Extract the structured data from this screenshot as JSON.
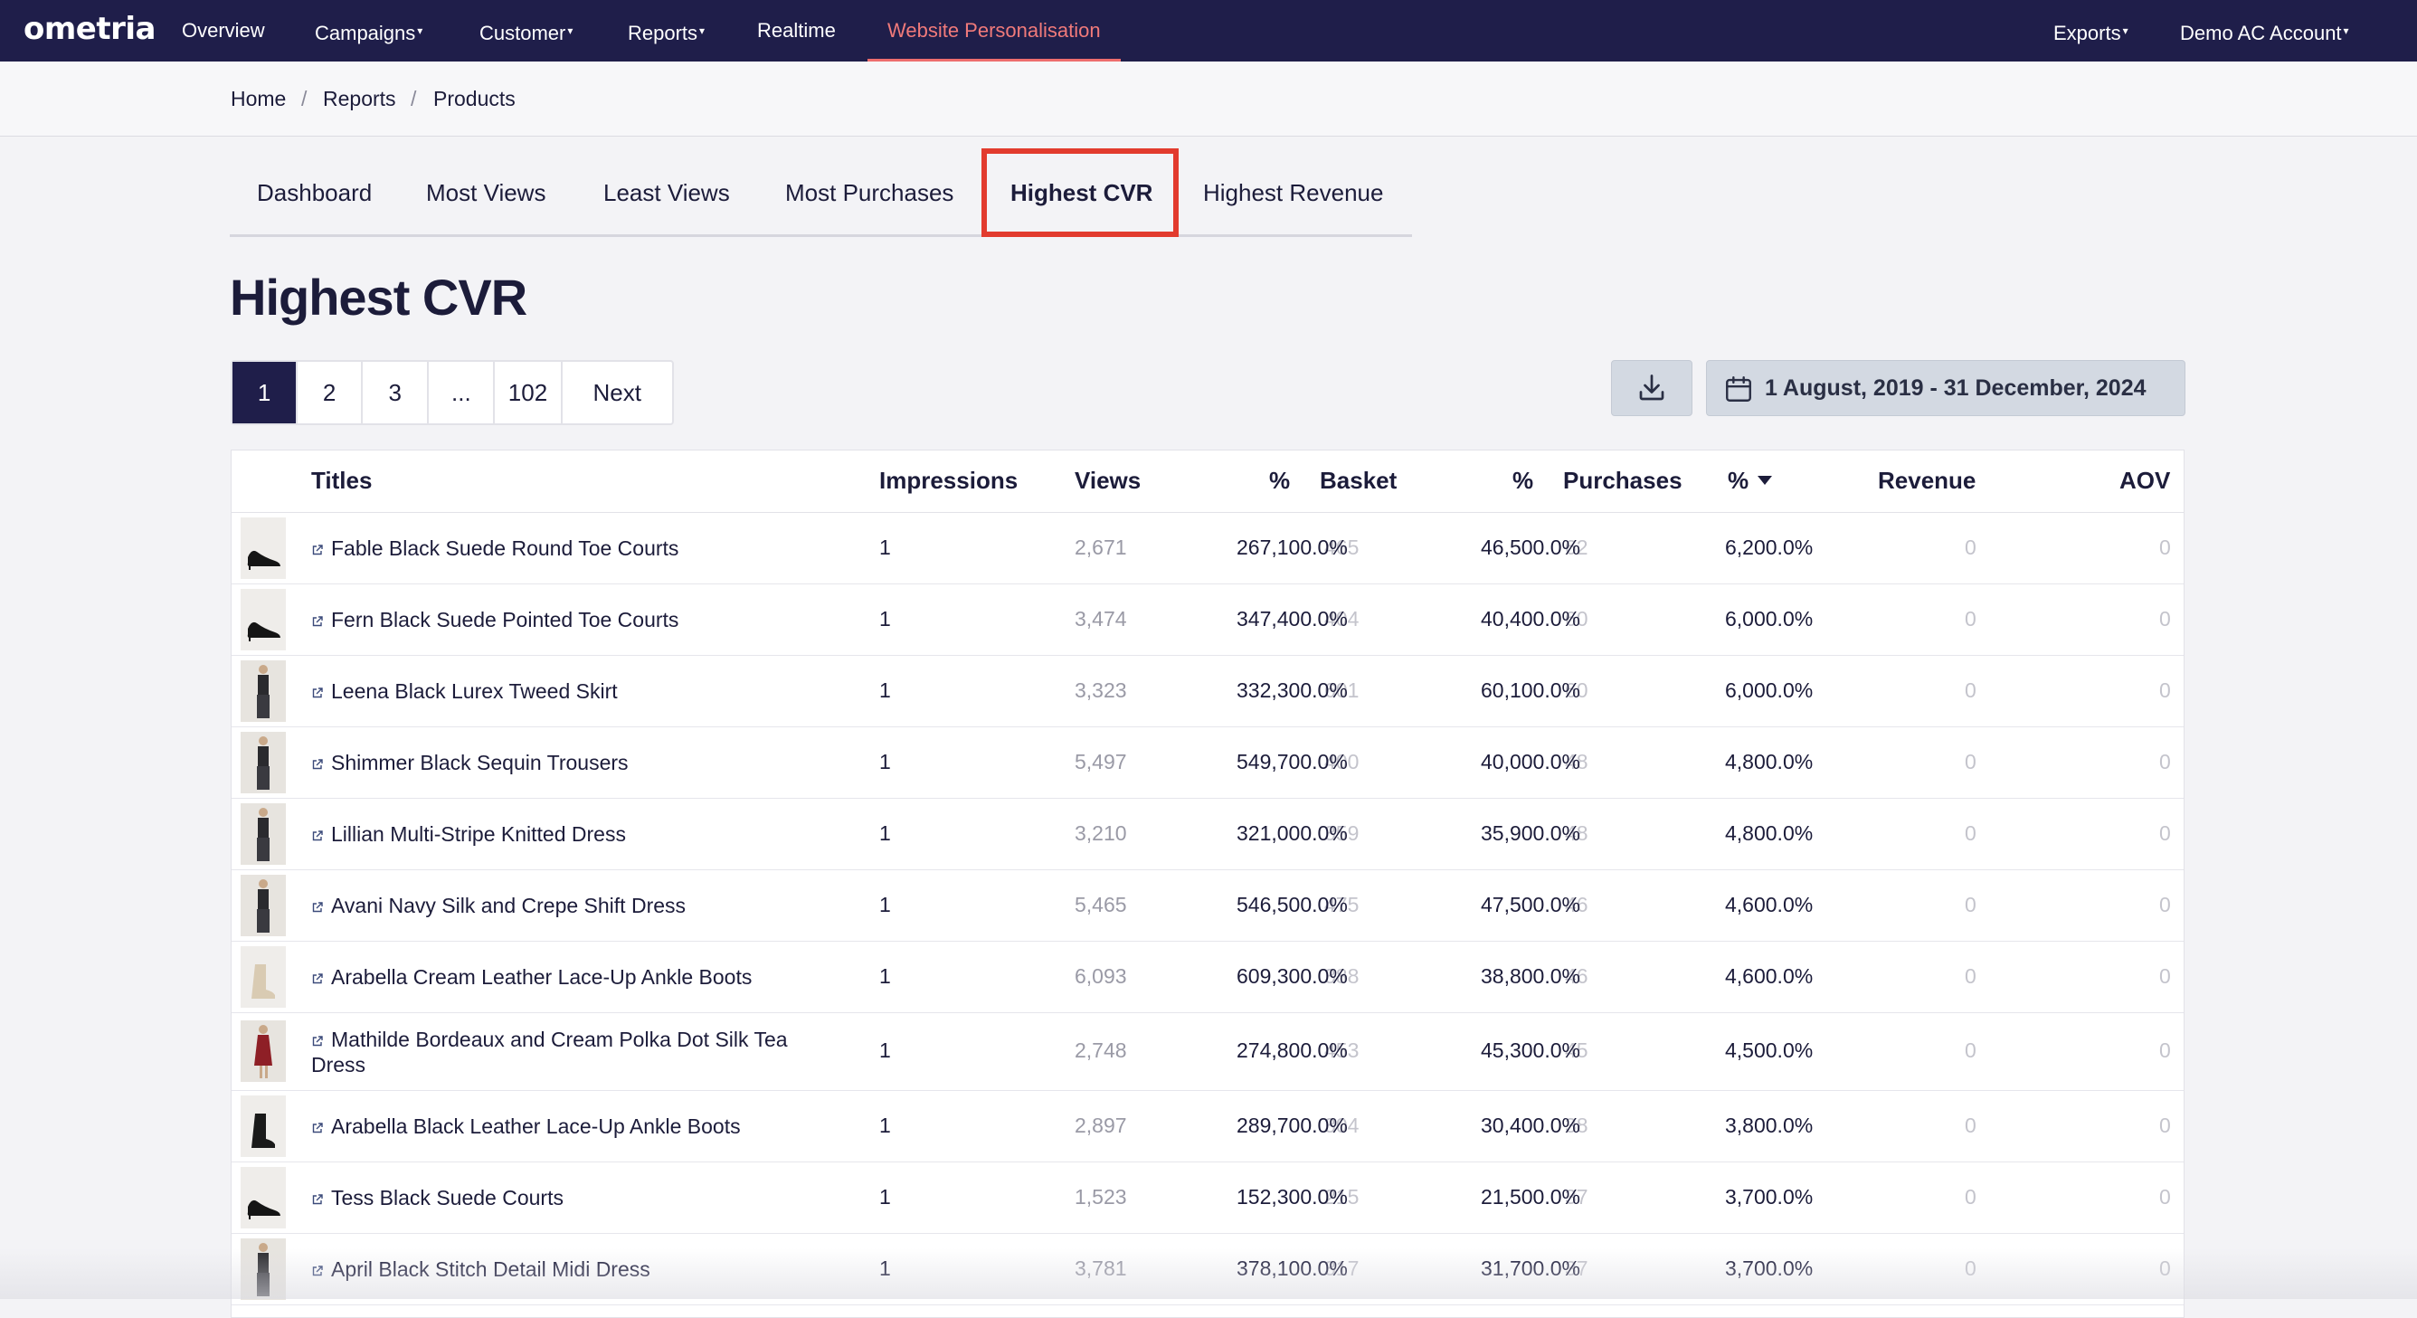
{
  "nav": {
    "logo": "ometria",
    "items": [
      {
        "label": "Overview"
      },
      {
        "label": "Campaigns",
        "caret": "▾"
      },
      {
        "label": "Customer",
        "caret": "▾"
      },
      {
        "label": "Reports",
        "caret": "▾"
      },
      {
        "label": "Realtime"
      },
      {
        "label": "Website Personalisation"
      }
    ],
    "right": [
      {
        "label": "Exports",
        "caret": "▾"
      },
      {
        "label": "Demo AC Account",
        "caret": "▾"
      }
    ]
  },
  "breadcrumb": [
    "Home",
    "Reports",
    "Products"
  ],
  "breadcrumb_sep": "/",
  "tabs": [
    "Dashboard",
    "Most Views",
    "Least Views",
    "Most Purchases",
    "Highest CVR",
    "Highest Revenue"
  ],
  "title": "Highest CVR",
  "pagination": [
    "1",
    "2",
    "3",
    "...",
    "102",
    "Next"
  ],
  "date_range": "1 August, 2019 - 31 December, 2024",
  "columns": {
    "titles": "Titles",
    "impressions": "Impressions",
    "views": "Views",
    "pct1": "%",
    "basket": "Basket",
    "pct2": "%",
    "purchases": "Purchases",
    "pct3": "%",
    "revenue": "Revenue",
    "aov": "AOV"
  },
  "rows": [
    {
      "title": "Fable Black Suede Round Toe Courts",
      "impressions": "1",
      "views": "2,671",
      "pct1": "267,100.0%",
      "basket": "465",
      "pct2": "46,500.0%",
      "purchases": "62",
      "pct3": "6,200.0%",
      "revenue": "0",
      "aov": "0",
      "thumb": "shoe"
    },
    {
      "title": "Fern Black Suede Pointed Toe Courts",
      "impressions": "1",
      "views": "3,474",
      "pct1": "347,400.0%",
      "basket": "404",
      "pct2": "40,400.0%",
      "purchases": "60",
      "pct3": "6,000.0%",
      "revenue": "0",
      "aov": "0",
      "thumb": "shoe"
    },
    {
      "title": "Leena Black Lurex Tweed Skirt",
      "impressions": "1",
      "views": "3,323",
      "pct1": "332,300.0%",
      "basket": "601",
      "pct2": "60,100.0%",
      "purchases": "60",
      "pct3": "6,000.0%",
      "revenue": "0",
      "aov": "0",
      "thumb": "person"
    },
    {
      "title": "Shimmer Black Sequin Trousers",
      "impressions": "1",
      "views": "5,497",
      "pct1": "549,700.0%",
      "basket": "400",
      "pct2": "40,000.0%",
      "purchases": "48",
      "pct3": "4,800.0%",
      "revenue": "0",
      "aov": "0",
      "thumb": "person"
    },
    {
      "title": "Lillian Multi-Stripe Knitted Dress",
      "impressions": "1",
      "views": "3,210",
      "pct1": "321,000.0%",
      "basket": "359",
      "pct2": "35,900.0%",
      "purchases": "48",
      "pct3": "4,800.0%",
      "revenue": "0",
      "aov": "0",
      "thumb": "person"
    },
    {
      "title": "Avani Navy Silk and Crepe Shift Dress",
      "impressions": "1",
      "views": "5,465",
      "pct1": "546,500.0%",
      "basket": "475",
      "pct2": "47,500.0%",
      "purchases": "46",
      "pct3": "4,600.0%",
      "revenue": "0",
      "aov": "0",
      "thumb": "person"
    },
    {
      "title": "Arabella Cream Leather Lace-Up Ankle Boots",
      "impressions": "1",
      "views": "6,093",
      "pct1": "609,300.0%",
      "basket": "388",
      "pct2": "38,800.0%",
      "purchases": "46",
      "pct3": "4,600.0%",
      "revenue": "0",
      "aov": "0",
      "thumb": "boot-cream"
    },
    {
      "title": "Mathilde Bordeaux and Cream Polka Dot Silk Tea Dress",
      "impressions": "1",
      "views": "2,748",
      "pct1": "274,800.0%",
      "basket": "453",
      "pct2": "45,300.0%",
      "purchases": "45",
      "pct3": "4,500.0%",
      "revenue": "0",
      "aov": "0",
      "thumb": "person-red"
    },
    {
      "title": "Arabella Black Leather Lace-Up Ankle Boots",
      "impressions": "1",
      "views": "2,897",
      "pct1": "289,700.0%",
      "basket": "304",
      "pct2": "30,400.0%",
      "purchases": "38",
      "pct3": "3,800.0%",
      "revenue": "0",
      "aov": "0",
      "thumb": "boot"
    },
    {
      "title": "Tess Black Suede Courts",
      "impressions": "1",
      "views": "1,523",
      "pct1": "152,300.0%",
      "basket": "215",
      "pct2": "21,500.0%",
      "purchases": "37",
      "pct3": "3,700.0%",
      "revenue": "0",
      "aov": "0",
      "thumb": "shoe"
    },
    {
      "title": "April Black Stitch Detail Midi Dress",
      "impressions": "1",
      "views": "3,781",
      "pct1": "378,100.0%",
      "basket": "317",
      "pct2": "31,700.0%",
      "purchases": "37",
      "pct3": "3,700.0%",
      "revenue": "0",
      "aov": "0",
      "thumb": "person"
    }
  ],
  "colors": {
    "nav_bg": "#1f1e4a",
    "active_nav": "#f07a7a",
    "highlight": "#e23b2e",
    "button_bg": "#d3d9e2"
  }
}
